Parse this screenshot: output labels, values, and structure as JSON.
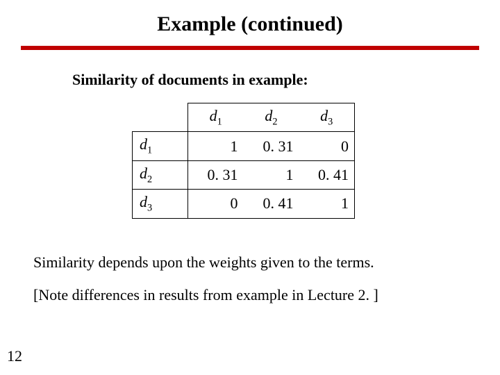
{
  "title": "Example (continued)",
  "subhead": "Similarity of documents in example:",
  "chart_data": {
    "type": "table",
    "title": "Similarity of documents",
    "row_labels": [
      "d1",
      "d2",
      "d3"
    ],
    "col_labels": [
      "d1",
      "d2",
      "d3"
    ],
    "values": [
      [
        1,
        0.31,
        0
      ],
      [
        0.31,
        1,
        0.41
      ],
      [
        0,
        0.41,
        1
      ]
    ]
  },
  "doc_prefix": "d",
  "subs": {
    "1": "1",
    "2": "2",
    "3": "3"
  },
  "cells": {
    "r1c1": "1",
    "r1c2": "0. 31",
    "r1c3": "0",
    "r2c1": "0. 31",
    "r2c2": "1",
    "r2c3": "0. 41",
    "r3c1": "0",
    "r3c2": "0. 41",
    "r3c3": "1"
  },
  "body": {
    "p1": "Similarity depends upon the weights given to the terms.",
    "p2": "[Note differences in results from example in Lecture 2. ]"
  },
  "pagenum": "12"
}
